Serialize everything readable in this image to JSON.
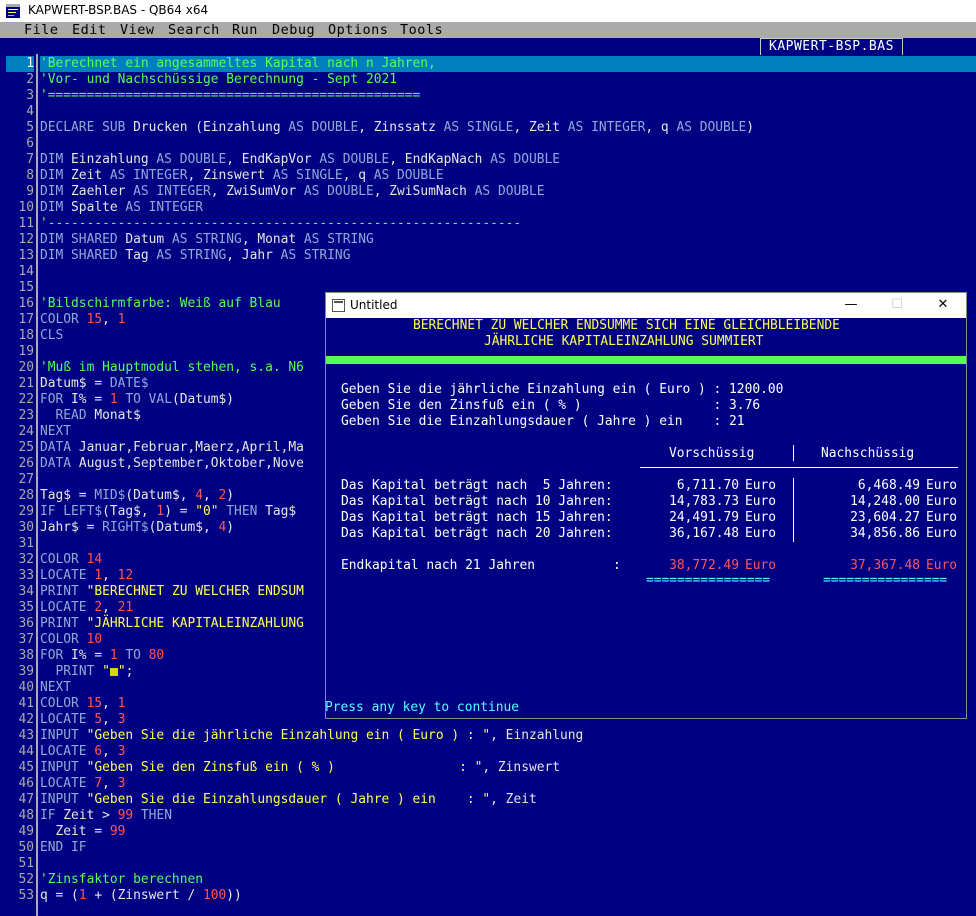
{
  "window": {
    "title": "KAPWERT-BSP.BAS - QB64 x64"
  },
  "menu": [
    "File",
    "Edit",
    "View",
    "Search",
    "Run",
    "Debug",
    "Options",
    "Tools"
  ],
  "editor": {
    "file_tab": "KAPWERT-BSP.BAS",
    "line_numbers": [
      "1",
      "2",
      "3",
      "4",
      "5",
      "6",
      "7",
      "8",
      "9",
      "10",
      "11",
      "12",
      "13",
      "14",
      "15",
      "16",
      "17",
      "18",
      "19",
      "20",
      "21",
      "22",
      "23",
      "24",
      "25",
      "26",
      "27",
      "28",
      "29",
      "30",
      "31",
      "32",
      "33",
      "34",
      "35",
      "36",
      "37",
      "38",
      "39",
      "40",
      "41",
      "42",
      "43",
      "44",
      "45",
      "46",
      "47",
      "48",
      "49",
      "50",
      "51",
      "52",
      "53"
    ],
    "current_line": 1,
    "lines": [
      [
        [
          "cmt",
          "'Berechnet ein angesammeltes Kapital nach n Jahren,"
        ]
      ],
      [
        [
          "cmt",
          "'Vor- und Nachschüssige Berechnung - Sept 2021"
        ]
      ],
      [
        [
          "cmt",
          "'================================================"
        ]
      ],
      [],
      [
        [
          "kw",
          "DECLARE SUB "
        ],
        [
          "txt",
          "Drucken (Einzahlung "
        ],
        [
          "kw",
          "AS DOUBLE"
        ],
        [
          "txt",
          ", Zinssatz "
        ],
        [
          "kw",
          "AS SINGLE"
        ],
        [
          "txt",
          ", Zeit "
        ],
        [
          "kw",
          "AS INTEGER"
        ],
        [
          "txt",
          ", q "
        ],
        [
          "kw",
          "AS DOUBLE"
        ],
        [
          "txt",
          ")"
        ]
      ],
      [],
      [
        [
          "kw",
          "DIM "
        ],
        [
          "txt",
          "Einzahlung "
        ],
        [
          "kw",
          "AS DOUBLE"
        ],
        [
          "txt",
          ", EndKapVor "
        ],
        [
          "kw",
          "AS DOUBLE"
        ],
        [
          "txt",
          ", EndKapNach "
        ],
        [
          "kw",
          "AS DOUBLE"
        ]
      ],
      [
        [
          "kw",
          "DIM "
        ],
        [
          "txt",
          "Zeit "
        ],
        [
          "kw",
          "AS INTEGER"
        ],
        [
          "txt",
          ", Zinswert "
        ],
        [
          "kw",
          "AS SINGLE"
        ],
        [
          "txt",
          ", q "
        ],
        [
          "kw",
          "AS DOUBLE"
        ]
      ],
      [
        [
          "kw",
          "DIM "
        ],
        [
          "txt",
          "Zaehler "
        ],
        [
          "kw",
          "AS INTEGER"
        ],
        [
          "txt",
          ", ZwiSumVor "
        ],
        [
          "kw",
          "AS DOUBLE"
        ],
        [
          "txt",
          ", ZwiSumNach "
        ],
        [
          "kw",
          "AS DOUBLE"
        ]
      ],
      [
        [
          "kw",
          "DIM "
        ],
        [
          "txt",
          "Spalte "
        ],
        [
          "kw",
          "AS INTEGER"
        ]
      ],
      [
        [
          "cmt",
          "'-------------------------------------------------------------"
        ]
      ],
      [
        [
          "kw",
          "DIM SHARED "
        ],
        [
          "txt",
          "Datum "
        ],
        [
          "kw",
          "AS STRING"
        ],
        [
          "txt",
          ", Monat "
        ],
        [
          "kw",
          "AS STRING"
        ]
      ],
      [
        [
          "kw",
          "DIM SHARED "
        ],
        [
          "txt",
          "Tag "
        ],
        [
          "kw",
          "AS STRING"
        ],
        [
          "txt",
          ", Jahr "
        ],
        [
          "kw",
          "AS STRING"
        ]
      ],
      [],
      [],
      [
        [
          "cmt",
          "'Bildschirmfarbe: Weiß auf Blau"
        ]
      ],
      [
        [
          "kw",
          "COLOR "
        ],
        [
          "num",
          "15"
        ],
        [
          "txt",
          ", "
        ],
        [
          "num",
          "1"
        ]
      ],
      [
        [
          "kw",
          "CLS"
        ]
      ],
      [],
      [
        [
          "cmt",
          "'Muß im Hauptmodul stehen, s.a. N6"
        ]
      ],
      [
        [
          "txt",
          "Datum$ = "
        ],
        [
          "kw",
          "DATE$"
        ]
      ],
      [
        [
          "kw",
          "FOR "
        ],
        [
          "txt",
          "I% = "
        ],
        [
          "num",
          "1"
        ],
        [
          "kw",
          " TO "
        ],
        [
          "kw",
          "VAL"
        ],
        [
          "txt",
          "(Datum$)"
        ]
      ],
      [
        [
          "txt",
          "  "
        ],
        [
          "kw",
          "READ "
        ],
        [
          "txt",
          "Monat$"
        ]
      ],
      [
        [
          "kw",
          "NEXT"
        ]
      ],
      [
        [
          "kw",
          "DATA "
        ],
        [
          "txt",
          "Januar,Februar,Maerz,April,Ma"
        ]
      ],
      [
        [
          "kw",
          "DATA "
        ],
        [
          "txt",
          "August,September,Oktober,Nove"
        ]
      ],
      [],
      [
        [
          "txt",
          "Tag$ = "
        ],
        [
          "kw",
          "MID$"
        ],
        [
          "txt",
          "(Datum$, "
        ],
        [
          "num",
          "4"
        ],
        [
          "txt",
          ", "
        ],
        [
          "num",
          "2"
        ],
        [
          "txt",
          ")"
        ]
      ],
      [
        [
          "kw",
          "IF LEFT$"
        ],
        [
          "txt",
          "(Tag$, "
        ],
        [
          "num",
          "1"
        ],
        [
          "txt",
          ") = "
        ],
        [
          "str",
          "\"0\""
        ],
        [
          "kw",
          " THEN "
        ],
        [
          "txt",
          "Tag$"
        ]
      ],
      [
        [
          "txt",
          "Jahr$ = "
        ],
        [
          "kw",
          "RIGHT$"
        ],
        [
          "txt",
          "(Datum$, "
        ],
        [
          "num",
          "4"
        ],
        [
          "txt",
          ")"
        ]
      ],
      [],
      [
        [
          "kw",
          "COLOR "
        ],
        [
          "num",
          "14"
        ]
      ],
      [
        [
          "kw",
          "LOCATE "
        ],
        [
          "num",
          "1"
        ],
        [
          "txt",
          ", "
        ],
        [
          "num",
          "12"
        ]
      ],
      [
        [
          "kw",
          "PRINT "
        ],
        [
          "str",
          "\"BERECHNET ZU WELCHER ENDSUM"
        ]
      ],
      [
        [
          "kw",
          "LOCATE "
        ],
        [
          "num",
          "2"
        ],
        [
          "txt",
          ", "
        ],
        [
          "num",
          "21"
        ]
      ],
      [
        [
          "kw",
          "PRINT "
        ],
        [
          "str",
          "\"JÄHRLICHE KAPITALEINZAHLUNG"
        ]
      ],
      [
        [
          "kw",
          "COLOR "
        ],
        [
          "num",
          "10"
        ]
      ],
      [
        [
          "kw",
          "FOR "
        ],
        [
          "txt",
          "I% = "
        ],
        [
          "num",
          "1"
        ],
        [
          "kw",
          " TO "
        ],
        [
          "num",
          "80"
        ]
      ],
      [
        [
          "txt",
          "  "
        ],
        [
          "kw",
          "PRINT "
        ],
        [
          "str",
          "\""
        ],
        [
          "cursor",
          ""
        ],
        [
          "str",
          "\""
        ],
        [
          "txt",
          ";"
        ]
      ],
      [
        [
          "kw",
          "NEXT"
        ]
      ],
      [
        [
          "kw",
          "COLOR "
        ],
        [
          "num",
          "15"
        ],
        [
          "txt",
          ", "
        ],
        [
          "num",
          "1"
        ]
      ],
      [
        [
          "kw",
          "LOCATE "
        ],
        [
          "num",
          "5"
        ],
        [
          "txt",
          ", "
        ],
        [
          "num",
          "3"
        ]
      ],
      [
        [
          "kw",
          "INPUT "
        ],
        [
          "str",
          "\"Geben Sie die jährliche Einzahlung ein ( Euro ) : \""
        ],
        [
          "txt",
          ", Einzahlung"
        ]
      ],
      [
        [
          "kw",
          "LOCATE "
        ],
        [
          "num",
          "6"
        ],
        [
          "txt",
          ", "
        ],
        [
          "num",
          "3"
        ]
      ],
      [
        [
          "kw",
          "INPUT "
        ],
        [
          "str",
          "\"Geben Sie den Zinsfuß ein ( % )                : \""
        ],
        [
          "txt",
          ", Zinswert"
        ]
      ],
      [
        [
          "kw",
          "LOCATE "
        ],
        [
          "num",
          "7"
        ],
        [
          "txt",
          ", "
        ],
        [
          "num",
          "3"
        ]
      ],
      [
        [
          "kw",
          "INPUT "
        ],
        [
          "str",
          "\"Geben Sie die Einzahlungsdauer ( Jahre ) ein    : \""
        ],
        [
          "txt",
          ", Zeit"
        ]
      ],
      [
        [
          "kw",
          "IF "
        ],
        [
          "txt",
          "Zeit > "
        ],
        [
          "num",
          "99"
        ],
        [
          "kw",
          " THEN"
        ]
      ],
      [
        [
          "txt",
          "  Zeit = "
        ],
        [
          "num",
          "99"
        ]
      ],
      [
        [
          "kw",
          "END IF"
        ]
      ],
      [],
      [
        [
          "cmt",
          "'Zinsfaktor berechnen"
        ]
      ],
      [
        [
          "txt",
          "q = ("
        ],
        [
          "num",
          "1"
        ],
        [
          "txt",
          " + (Zinswert / "
        ],
        [
          "num",
          "100"
        ],
        [
          "txt",
          "))"
        ]
      ]
    ]
  },
  "output_window": {
    "title": "Untitled",
    "controls": {
      "minimize": "—",
      "maximize": "☐",
      "close": "✕"
    },
    "header1": "BERECHNET ZU WELCHER ENDSUMME SICH EINE GLEICHBLEIBENDE",
    "header2": "JÄHRLICHE KAPITALEINZAHLUNG SUMMIERT",
    "inputs": [
      "Geben Sie die jährliche Einzahlung ein ( Euro ) : 1200.00",
      "Geben Sie den Zinsfuß ein ( % )                 : 3.76",
      "Geben Sie die Einzahlungsdauer ( Jahre ) ein    : 21"
    ],
    "col_vor": "Vorschüssig",
    "col_nach": "Nachschüssig",
    "rows": [
      {
        "label": "Das Kapital beträgt nach  5 Jahren:",
        "vor": "6,711.70",
        "nach": "6,468.49"
      },
      {
        "label": "Das Kapital beträgt nach 10 Jahren:",
        "vor": "14,783.73",
        "nach": "14,248.00"
      },
      {
        "label": "Das Kapital beträgt nach 15 Jahren:",
        "vor": "24,491.79",
        "nach": "23,604.27"
      },
      {
        "label": "Das Kapital beträgt nach 20 Jahren:",
        "vor": "36,167.48",
        "nach": "34,856.86"
      }
    ],
    "currency": "Euro",
    "end_label": "Endkapital nach 21 Jahren",
    "end_colon": ":",
    "end_vor": "38,772.49",
    "end_nach": "37,367.48",
    "double_underline": "================",
    "prompt": "Press any key to continue"
  },
  "colors": {
    "background": "#000082",
    "menu": "#aaaaaa",
    "current_line": "#007fbf",
    "comment": "#55ff55",
    "keyword": "#8eaadc",
    "number": "#ff5555",
    "string": "#ffff55",
    "output_red": "#ff5555",
    "output_cyan": "#55ffff"
  }
}
